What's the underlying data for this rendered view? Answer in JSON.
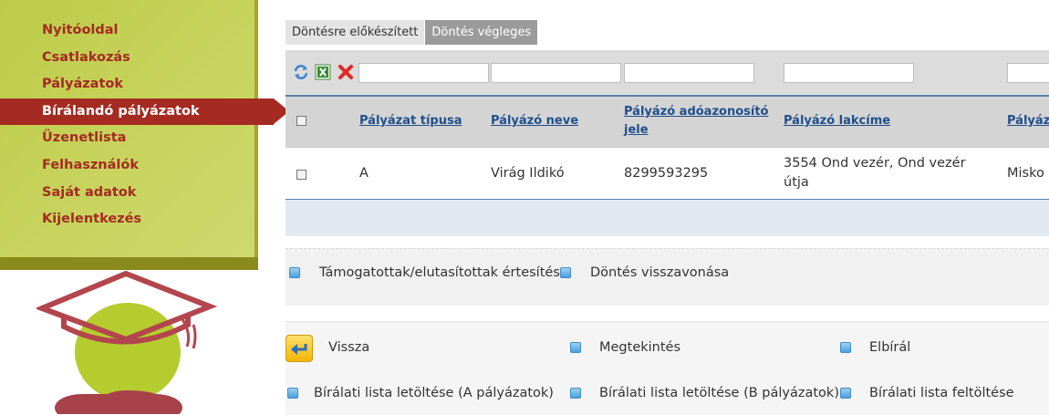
{
  "sidebar": {
    "items": [
      {
        "label": "Nyitóoldal"
      },
      {
        "label": "Csatlakozás"
      },
      {
        "label": "Pályázatok"
      },
      {
        "label": "Bírálandó pályázatok"
      },
      {
        "label": "Üzenetlista"
      },
      {
        "label": "Felhasználók"
      },
      {
        "label": "Saját adatok"
      },
      {
        "label": "Kijelentkezés"
      }
    ],
    "active_index": 3
  },
  "tabs": [
    {
      "label": "Döntésre előkészített"
    },
    {
      "label": "Döntés végleges"
    }
  ],
  "toolbar": {
    "icons": [
      "refresh-icon",
      "excel-export-icon",
      "clear-filter-icon"
    ]
  },
  "table": {
    "columns": [
      {
        "label": "Pályázat típusa"
      },
      {
        "label": "Pályázó neve"
      },
      {
        "label": "Pályázó adóazonosító jele"
      },
      {
        "label": "Pályázó lakcíme"
      },
      {
        "label": "Pályáz"
      }
    ],
    "rows": [
      {
        "type": "A",
        "name": "Virág Ildikó",
        "tax_id": "8299593295",
        "address": "3554 Ond vezér, Ond vezér útja",
        "extra": "Misko"
      }
    ]
  },
  "actions1": [
    {
      "label": "Támogatottak/elutasítottak értesítése"
    },
    {
      "label": "Döntés visszavonása"
    }
  ],
  "actions2": [
    {
      "label": "Vissza"
    },
    {
      "label": "Megtekintés"
    },
    {
      "label": "Elbírál"
    },
    {
      "label": "Bírálati lista letöltése (A pályázatok)"
    },
    {
      "label": "Bírálati lista letöltése (B pályázatok)"
    },
    {
      "label": "Bírálati lista feltöltése"
    }
  ],
  "colors": {
    "accent": "#a52a22",
    "sidebar": "#c4d055",
    "link": "#1f4f8c"
  }
}
